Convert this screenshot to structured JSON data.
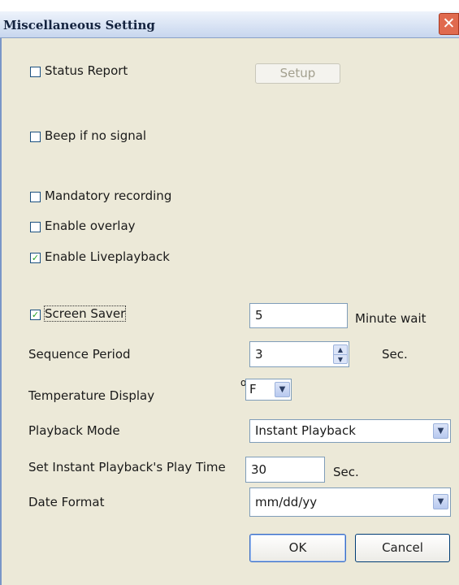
{
  "window": {
    "title": "Miscellaneous Setting",
    "close_glyph": "✕"
  },
  "checkboxes": {
    "status_report": {
      "label": "Status Report",
      "checked": false
    },
    "beep_no_signal": {
      "label": "Beep if no signal",
      "checked": false
    },
    "mandatory_recording": {
      "label": "Mandatory recording",
      "checked": false
    },
    "enable_overlay": {
      "label": "Enable overlay",
      "checked": false
    },
    "enable_liveplayback": {
      "label": "Enable Liveplayback",
      "checked": true
    },
    "screen_saver": {
      "label": "Screen Saver",
      "checked": true
    }
  },
  "setup_button": {
    "label": "Setup",
    "enabled": false
  },
  "screen_saver": {
    "value": "5",
    "unit": "Minute wait"
  },
  "sequence_period": {
    "label": "Sequence Period",
    "value": "3",
    "unit": "Sec."
  },
  "temperature": {
    "label": "Temperature Display",
    "degree": "o",
    "value": "F"
  },
  "playback_mode": {
    "label": "Playback Mode",
    "value": "Instant Playback"
  },
  "instant_play_time": {
    "label": "Set Instant Playback's Play Time",
    "value": "30",
    "unit": "Sec."
  },
  "date_format": {
    "label": "Date Format",
    "value": "mm/dd/yy"
  },
  "buttons": {
    "ok": "OK",
    "cancel": "Cancel"
  },
  "glyphs": {
    "check": "✓",
    "dropdown": "▼",
    "spin_up": "▲",
    "spin_down": "▼"
  },
  "colors": {
    "dialog_bg": "#ece9d8",
    "title_text": "#14233f",
    "close_bg": "#e06a4f"
  }
}
